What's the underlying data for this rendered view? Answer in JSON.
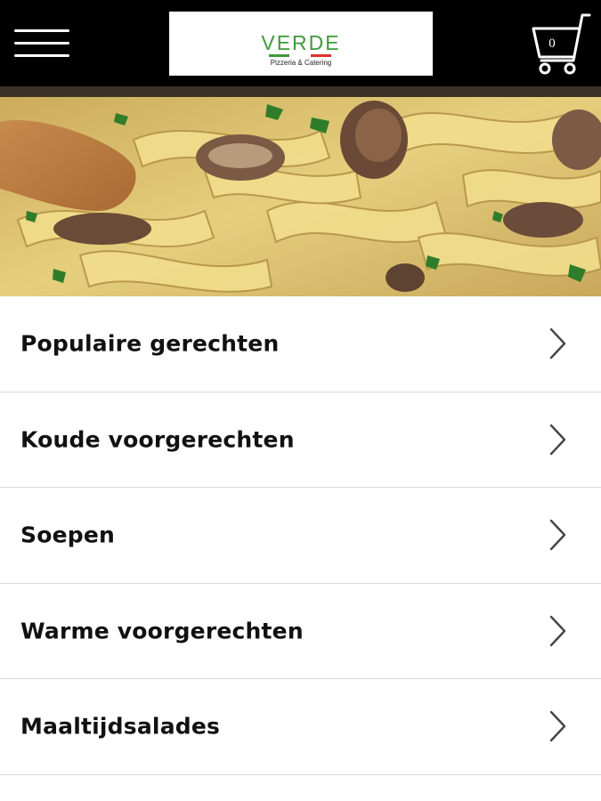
{
  "header": {
    "menu_icon": "hamburger-menu-icon",
    "logo": {
      "wordmark": "VERDE",
      "tagline": "Pizzeria & Catering",
      "accent_colors": [
        "#3f9a3a",
        "#ffffff",
        "#d9322b"
      ]
    },
    "cart": {
      "icon": "shopping-cart-icon",
      "count": "0"
    }
  },
  "hero": {
    "icon": "pasta-mushroom-photo"
  },
  "categories": [
    {
      "label": "Populaire gerechten"
    },
    {
      "label": "Koude voorgerechten"
    },
    {
      "label": "Soepen"
    },
    {
      "label": "Warme voorgerechten"
    },
    {
      "label": "Maaltijdsalades"
    }
  ],
  "colors": {
    "topbar": "#000000",
    "text": "#111111",
    "divider": "#d8d8d8",
    "chevron": "#444444"
  }
}
